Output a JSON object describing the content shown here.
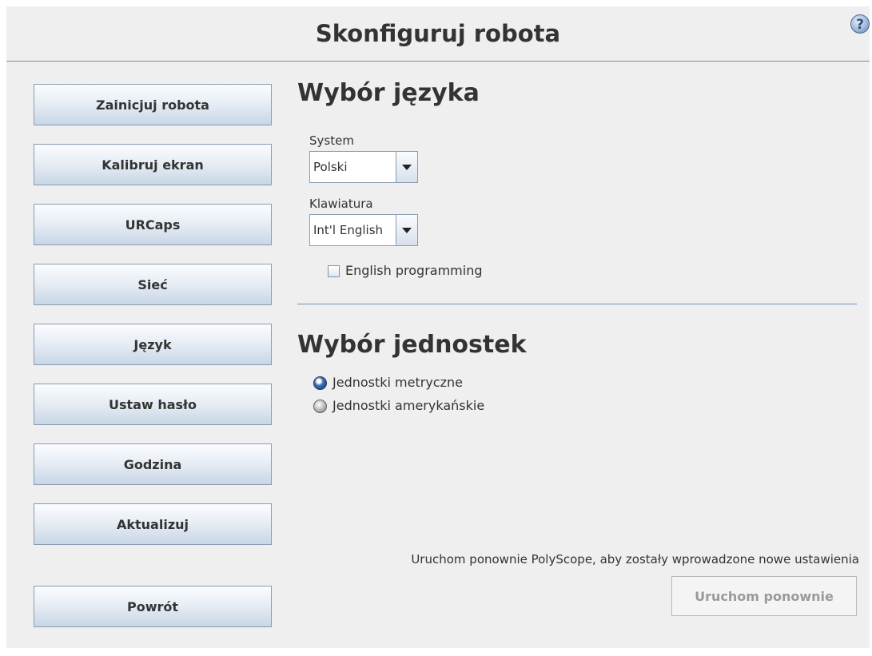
{
  "header": {
    "title": "Skonfiguruj robota",
    "help_icon": "question-mark-circle-icon",
    "help_glyph": "?"
  },
  "sidebar": {
    "items": [
      {
        "label": "Zainicjuj robota"
      },
      {
        "label": "Kalibruj ekran"
      },
      {
        "label": "URCaps"
      },
      {
        "label": "Sieć"
      },
      {
        "label": "Język"
      },
      {
        "label": "Ustaw hasło"
      },
      {
        "label": "Godzina"
      },
      {
        "label": "Aktualizuj"
      }
    ],
    "back_label": "Powrót"
  },
  "language": {
    "title": "Wybór języka",
    "system_label": "System",
    "system_value": "Polski",
    "keyboard_label": "Klawiatura",
    "keyboard_value": "Int'l English",
    "english_programming_label": "English programming",
    "english_programming_checked": false
  },
  "units": {
    "title": "Wybór jednostek",
    "options": [
      {
        "label": "Jednostki metryczne",
        "selected": true
      },
      {
        "label": "Jednostki amerykańskie",
        "selected": false
      }
    ]
  },
  "restart": {
    "note": "Uruchom ponownie PolyScope, aby zostały wprowadzone nowe ustawienia",
    "button_label": "Uruchom ponownie",
    "enabled": false
  }
}
